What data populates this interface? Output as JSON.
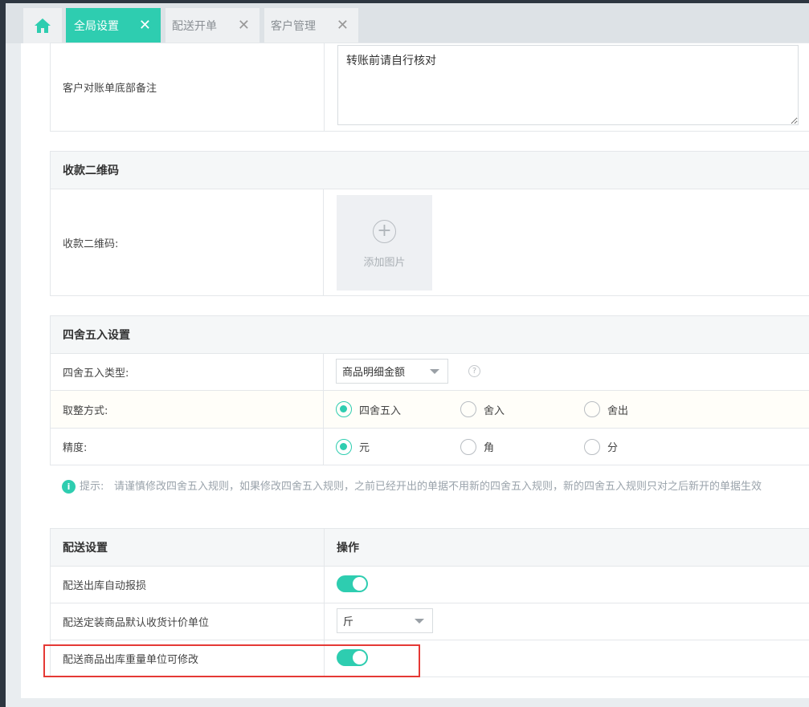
{
  "tabs": {
    "home_icon": "home-icon",
    "items": [
      {
        "label": "全局设置",
        "active": true
      },
      {
        "label": "配送开单",
        "active": false
      },
      {
        "label": "客户管理",
        "active": false
      }
    ],
    "close_glyph": "✕"
  },
  "remark": {
    "label": "客户对账单底部备注",
    "value": "转账前请自行核对"
  },
  "qrcode": {
    "section_title": "收款二维码",
    "label": "收款二维码:",
    "upload_text": "添加图片"
  },
  "rounding": {
    "section_title": "四舍五入设置",
    "type_label": "四舍五入类型:",
    "type_value": "商品明细金额",
    "mode_label": "取整方式:",
    "mode_options": [
      "四舍五入",
      "舍入",
      "舍出"
    ],
    "mode_selected": 0,
    "precision_label": "精度:",
    "precision_options": [
      "元",
      "角",
      "分"
    ],
    "precision_selected": 0,
    "hint_label": "提示:",
    "hint_text": "请谨慎修改四舍五入规则，如果修改四舍五入规则，之前已经开出的单据不用新的四舍五入规则，新的四舍五入规则只对之后新开的单据生效"
  },
  "delivery": {
    "section_title": "配送设置",
    "action_header": "操作",
    "auto_loss_label": "配送出库自动报损",
    "auto_loss_on": true,
    "default_unit_label": "配送定装商品默认收货计价单位",
    "default_unit_value": "斤",
    "weight_unit_label": "配送商品出库重量单位可修改",
    "weight_unit_on": true
  },
  "colors": {
    "accent": "#2ecdb0",
    "highlight_border": "#e53935"
  }
}
